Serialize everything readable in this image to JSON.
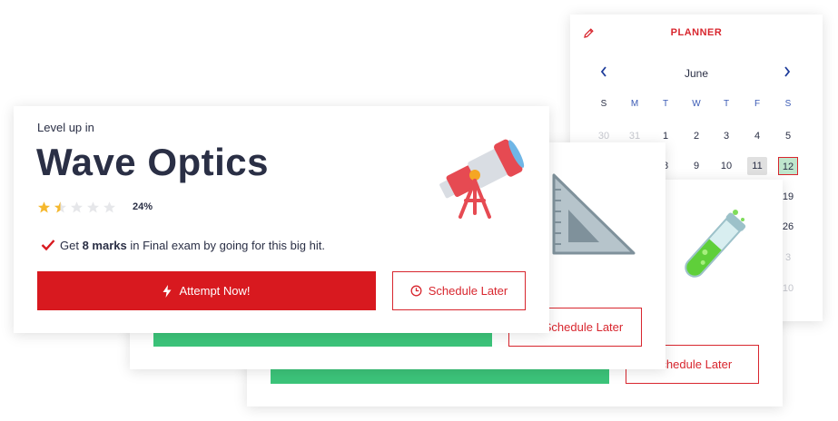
{
  "planner": {
    "title": "PLANNER",
    "month": "June",
    "day_headers": [
      "S",
      "M",
      "T",
      "W",
      "T",
      "F",
      "S"
    ],
    "row1": [
      "30",
      "31",
      "1",
      "2",
      "3",
      "4",
      "5"
    ],
    "row2": [
      "8",
      "9",
      "10",
      "11",
      "12"
    ],
    "visible_right": [
      "19",
      "26",
      "3",
      "10"
    ],
    "marked_day": "11",
    "selected_day": "12"
  },
  "card_front": {
    "eyebrow": "Level up in",
    "topic": "Wave Optics",
    "rating_stars": 1.5,
    "rating_max": 5,
    "progress_label": "24%",
    "benefit_prefix": "Get ",
    "benefit_bold": "8 marks",
    "benefit_suffix": " in Final exam by going for this big hit.",
    "primary_button": "Attempt Now!",
    "secondary_button": "Schedule Later",
    "illustration": "telescope-icon"
  },
  "card_back1": {
    "secondary_button": "Schedule Later",
    "illustration": "set-square-icon"
  },
  "card_back2": {
    "secondary_button": "Schedule Later",
    "illustration": "test-tube-icon"
  },
  "colors": {
    "accent_red": "#d8191f",
    "text_dark": "#2a2f45",
    "green": "#3cc47a",
    "calendar_blue": "#3b5bb5"
  }
}
